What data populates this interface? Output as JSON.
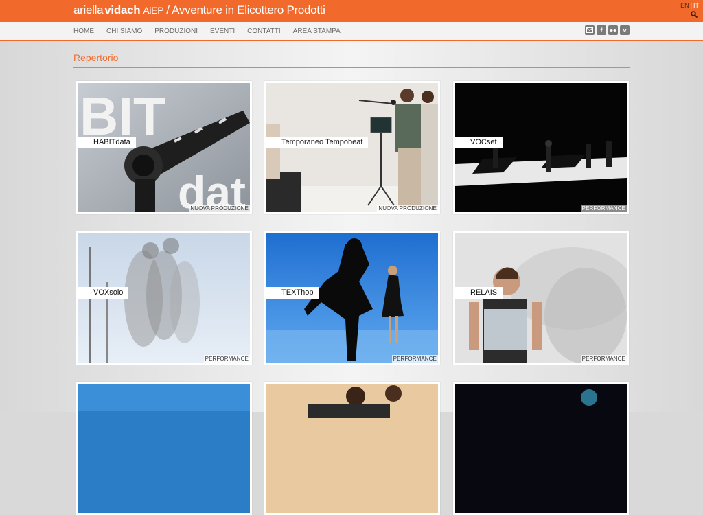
{
  "header": {
    "brand_name_1": "ariella",
    "brand_name_2": "vidach",
    "brand_suffix": "AiEP",
    "brand_subtitle": "/ Avventure in Elicottero Prodotti",
    "lang_en": "EN",
    "lang_sep": "|",
    "lang_it": "IT"
  },
  "nav": {
    "items": [
      "HOME",
      "CHI SIAMO",
      "PRODUZIONI",
      "EVENTI",
      "CONTATTI",
      "AREA STAMPA"
    ]
  },
  "social": [
    "mail-icon",
    "facebook-icon",
    "flickr-icon",
    "vimeo-icon"
  ],
  "page": {
    "title": "Repertorio"
  },
  "cards": [
    {
      "title": "HABITdata",
      "tag": "NUOVA PRODUZIONE"
    },
    {
      "title": "Temporaneo Tempobeat",
      "tag": "NUOVA PRODUZIONE"
    },
    {
      "title": "VOCset",
      "tag": "PERFORMANCE"
    },
    {
      "title": "VOXsolo",
      "tag": "PERFORMANCE"
    },
    {
      "title": "TEXThop",
      "tag": "PERFORMANCE"
    },
    {
      "title": "RELAIS",
      "tag": "PERFORMANCE"
    }
  ],
  "colors": {
    "accent": "#f26a2b"
  }
}
